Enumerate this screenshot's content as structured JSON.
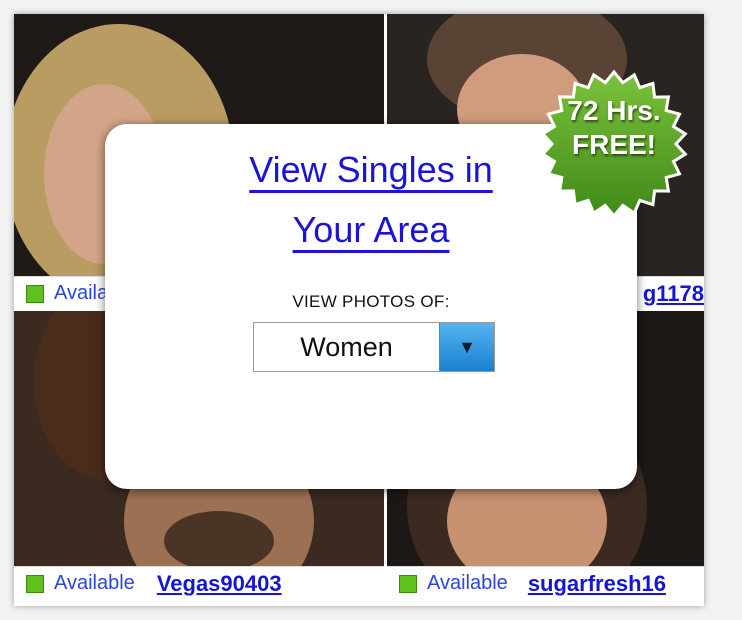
{
  "tiles": [
    {
      "status": "Available",
      "username": ""
    },
    {
      "status": "",
      "username": "g1178"
    },
    {
      "status": "Available",
      "username": "Vegas90403"
    },
    {
      "status": "Available",
      "username": "sugarfresh16"
    }
  ],
  "overlay": {
    "title_line1": "View Singles in",
    "title_line2": "Your Area",
    "view_label": "VIEW PHOTOS OF:",
    "select_value": "Women"
  },
  "badge": {
    "line1": "72 Hrs.",
    "line2": "FREE!"
  },
  "colors": {
    "status_green": "#5fc21a",
    "link_blue": "#1416d0",
    "badge_green": "#5aa623"
  }
}
